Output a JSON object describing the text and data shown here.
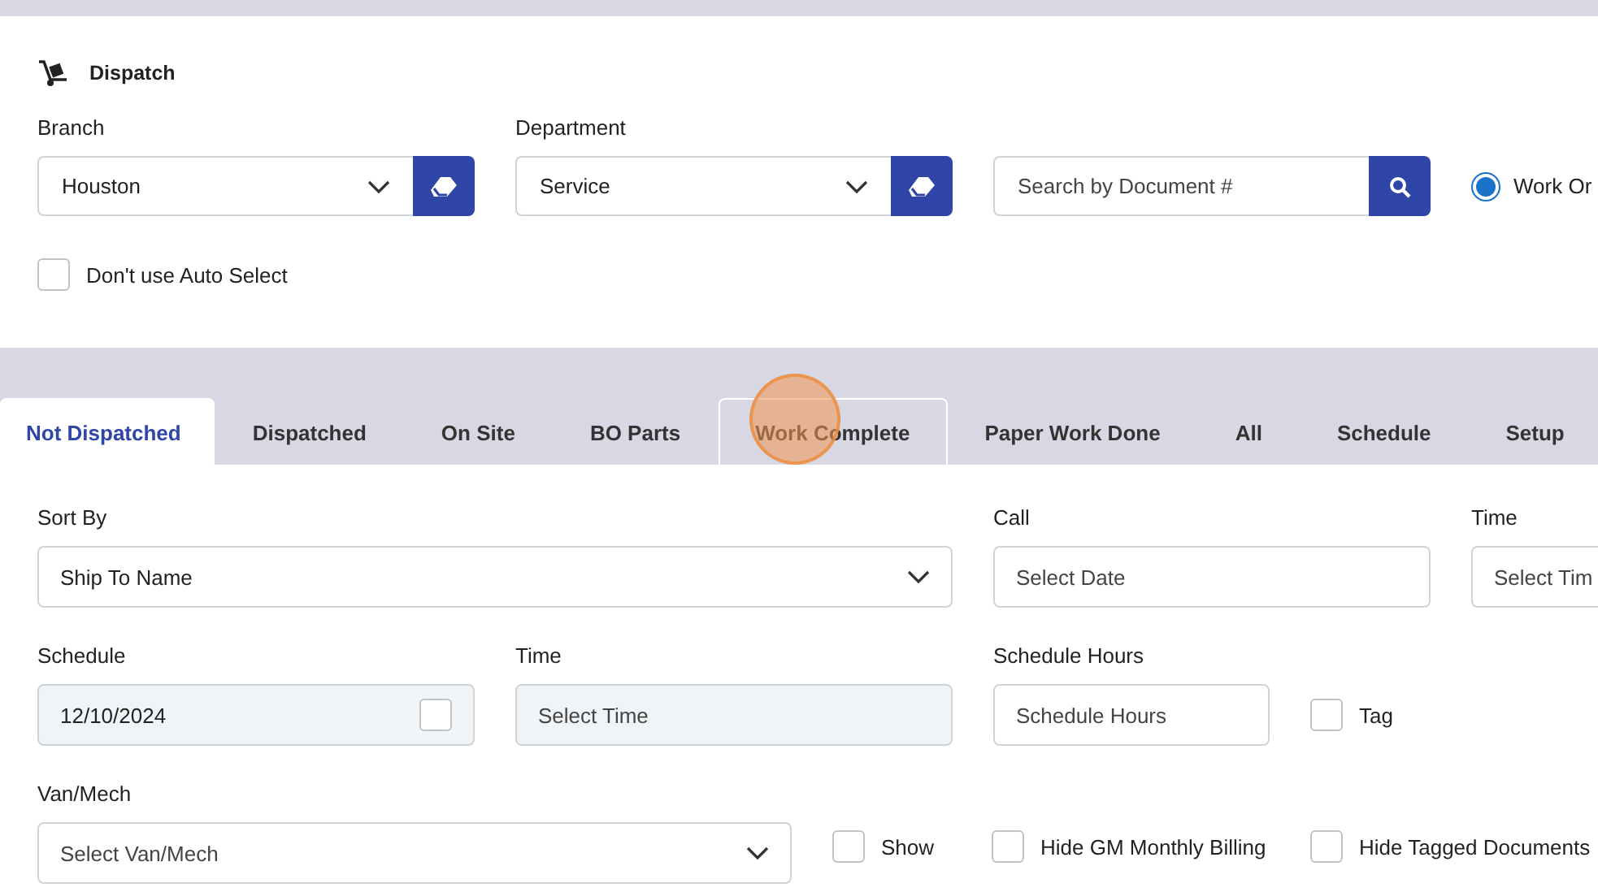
{
  "header": {
    "title": "Dispatch"
  },
  "filters": {
    "branch": {
      "label": "Branch",
      "value": "Houston"
    },
    "department": {
      "label": "Department",
      "value": "Service"
    },
    "search": {
      "placeholder": "Search by Document #"
    },
    "radio": {
      "label": "Work Or",
      "selected": true
    },
    "auto_select": {
      "label": "Don't use Auto Select",
      "checked": false
    }
  },
  "tabs": [
    {
      "label": "Not Dispatched",
      "selected": true,
      "hovered": false
    },
    {
      "label": "Dispatched",
      "selected": false,
      "hovered": false
    },
    {
      "label": "On Site",
      "selected": false,
      "hovered": false
    },
    {
      "label": "BO Parts",
      "selected": false,
      "hovered": false
    },
    {
      "label": "Work Complete",
      "selected": false,
      "hovered": true
    },
    {
      "label": "Paper Work Done",
      "selected": false,
      "hovered": false
    },
    {
      "label": "All",
      "selected": false,
      "hovered": false
    },
    {
      "label": "Schedule",
      "selected": false,
      "hovered": false
    },
    {
      "label": "Setup",
      "selected": false,
      "hovered": false
    }
  ],
  "form": {
    "sort_by": {
      "label": "Sort By",
      "value": "Ship To Name"
    },
    "call": {
      "label": "Call",
      "placeholder": "Select Date"
    },
    "call_time": {
      "label": "Time",
      "placeholder": "Select Tim"
    },
    "schedule": {
      "label": "Schedule",
      "value": "12/10/2024",
      "disabled": true,
      "checked": false
    },
    "schedule_time": {
      "label": "Time",
      "placeholder": "Select Time",
      "disabled": true
    },
    "schedule_hours": {
      "label": "Schedule Hours",
      "placeholder": "Schedule Hours"
    },
    "tag": {
      "label": "Tag",
      "checked": false
    },
    "van_mech": {
      "label": "Van/Mech",
      "placeholder": "Select Van/Mech"
    },
    "show": {
      "label": "Show",
      "checked": false
    },
    "hide_gm": {
      "label": "Hide GM Monthly Billing",
      "checked": false
    },
    "hide_tagged": {
      "label": "Hide Tagged Documents",
      "checked": false
    }
  }
}
